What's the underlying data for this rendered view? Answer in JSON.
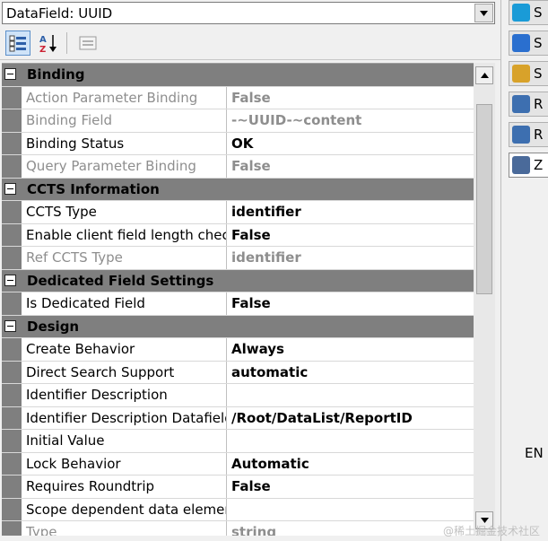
{
  "combo": {
    "value": "DataField: UUID"
  },
  "toolbar": {
    "buttons": [
      "categorized-icon",
      "alphabetical-icon",
      "property-pages-icon"
    ]
  },
  "categories": [
    {
      "label": "Binding",
      "rows": [
        {
          "name": "Action Parameter Binding",
          "value": "False",
          "dim": true
        },
        {
          "name": "Binding Field",
          "value": "-~UUID-~content",
          "dim": true
        },
        {
          "name": "Binding Status",
          "value": "OK",
          "dim": false
        },
        {
          "name": "Query Parameter Binding",
          "value": "False",
          "dim": true
        }
      ]
    },
    {
      "label": "CCTS Information",
      "rows": [
        {
          "name": "CCTS Type",
          "value": "identifier",
          "dim": false
        },
        {
          "name": "Enable client field length check",
          "value": "False",
          "dim": false
        },
        {
          "name": "Ref CCTS Type",
          "value": "identifier",
          "dim": true
        }
      ]
    },
    {
      "label": "Dedicated Field Settings",
      "rows": [
        {
          "name": "Is Dedicated Field",
          "value": "False",
          "dim": false
        }
      ]
    },
    {
      "label": "Design",
      "rows": [
        {
          "name": "Create Behavior",
          "value": "Always",
          "dim": false
        },
        {
          "name": "Direct Search Support",
          "value": "automatic",
          "dim": false
        },
        {
          "name": "Identifier Description",
          "value": "",
          "dim": false
        },
        {
          "name": "Identifier Description Datafield",
          "value": "/Root/DataList/ReportID",
          "dim": false
        },
        {
          "name": "Initial Value",
          "value": "",
          "dim": false
        },
        {
          "name": "Lock Behavior",
          "value": "Automatic",
          "dim": false
        },
        {
          "name": "Requires Roundtrip",
          "value": "False",
          "dim": false
        },
        {
          "name": "Scope dependent data element",
          "value": "",
          "dim": false
        },
        {
          "name": "Type",
          "value": "string",
          "dim": true
        }
      ]
    }
  ],
  "taskbar": [
    {
      "label": "S",
      "icon": "skype-icon",
      "color": "#1a9bd7"
    },
    {
      "label": "S",
      "icon": "ie-icon",
      "color": "#2a6fcf"
    },
    {
      "label": "S",
      "icon": "folder-icon",
      "color": "#d8a22a"
    },
    {
      "label": "R",
      "icon": "window-icon",
      "color": "#3d6fb0"
    },
    {
      "label": "R",
      "icon": "window-icon",
      "color": "#3d6fb0"
    },
    {
      "label": "Z",
      "icon": "app-icon",
      "color": "#4a6a9a"
    }
  ],
  "language": "EN",
  "watermark": "@稀土掘金技术社区"
}
